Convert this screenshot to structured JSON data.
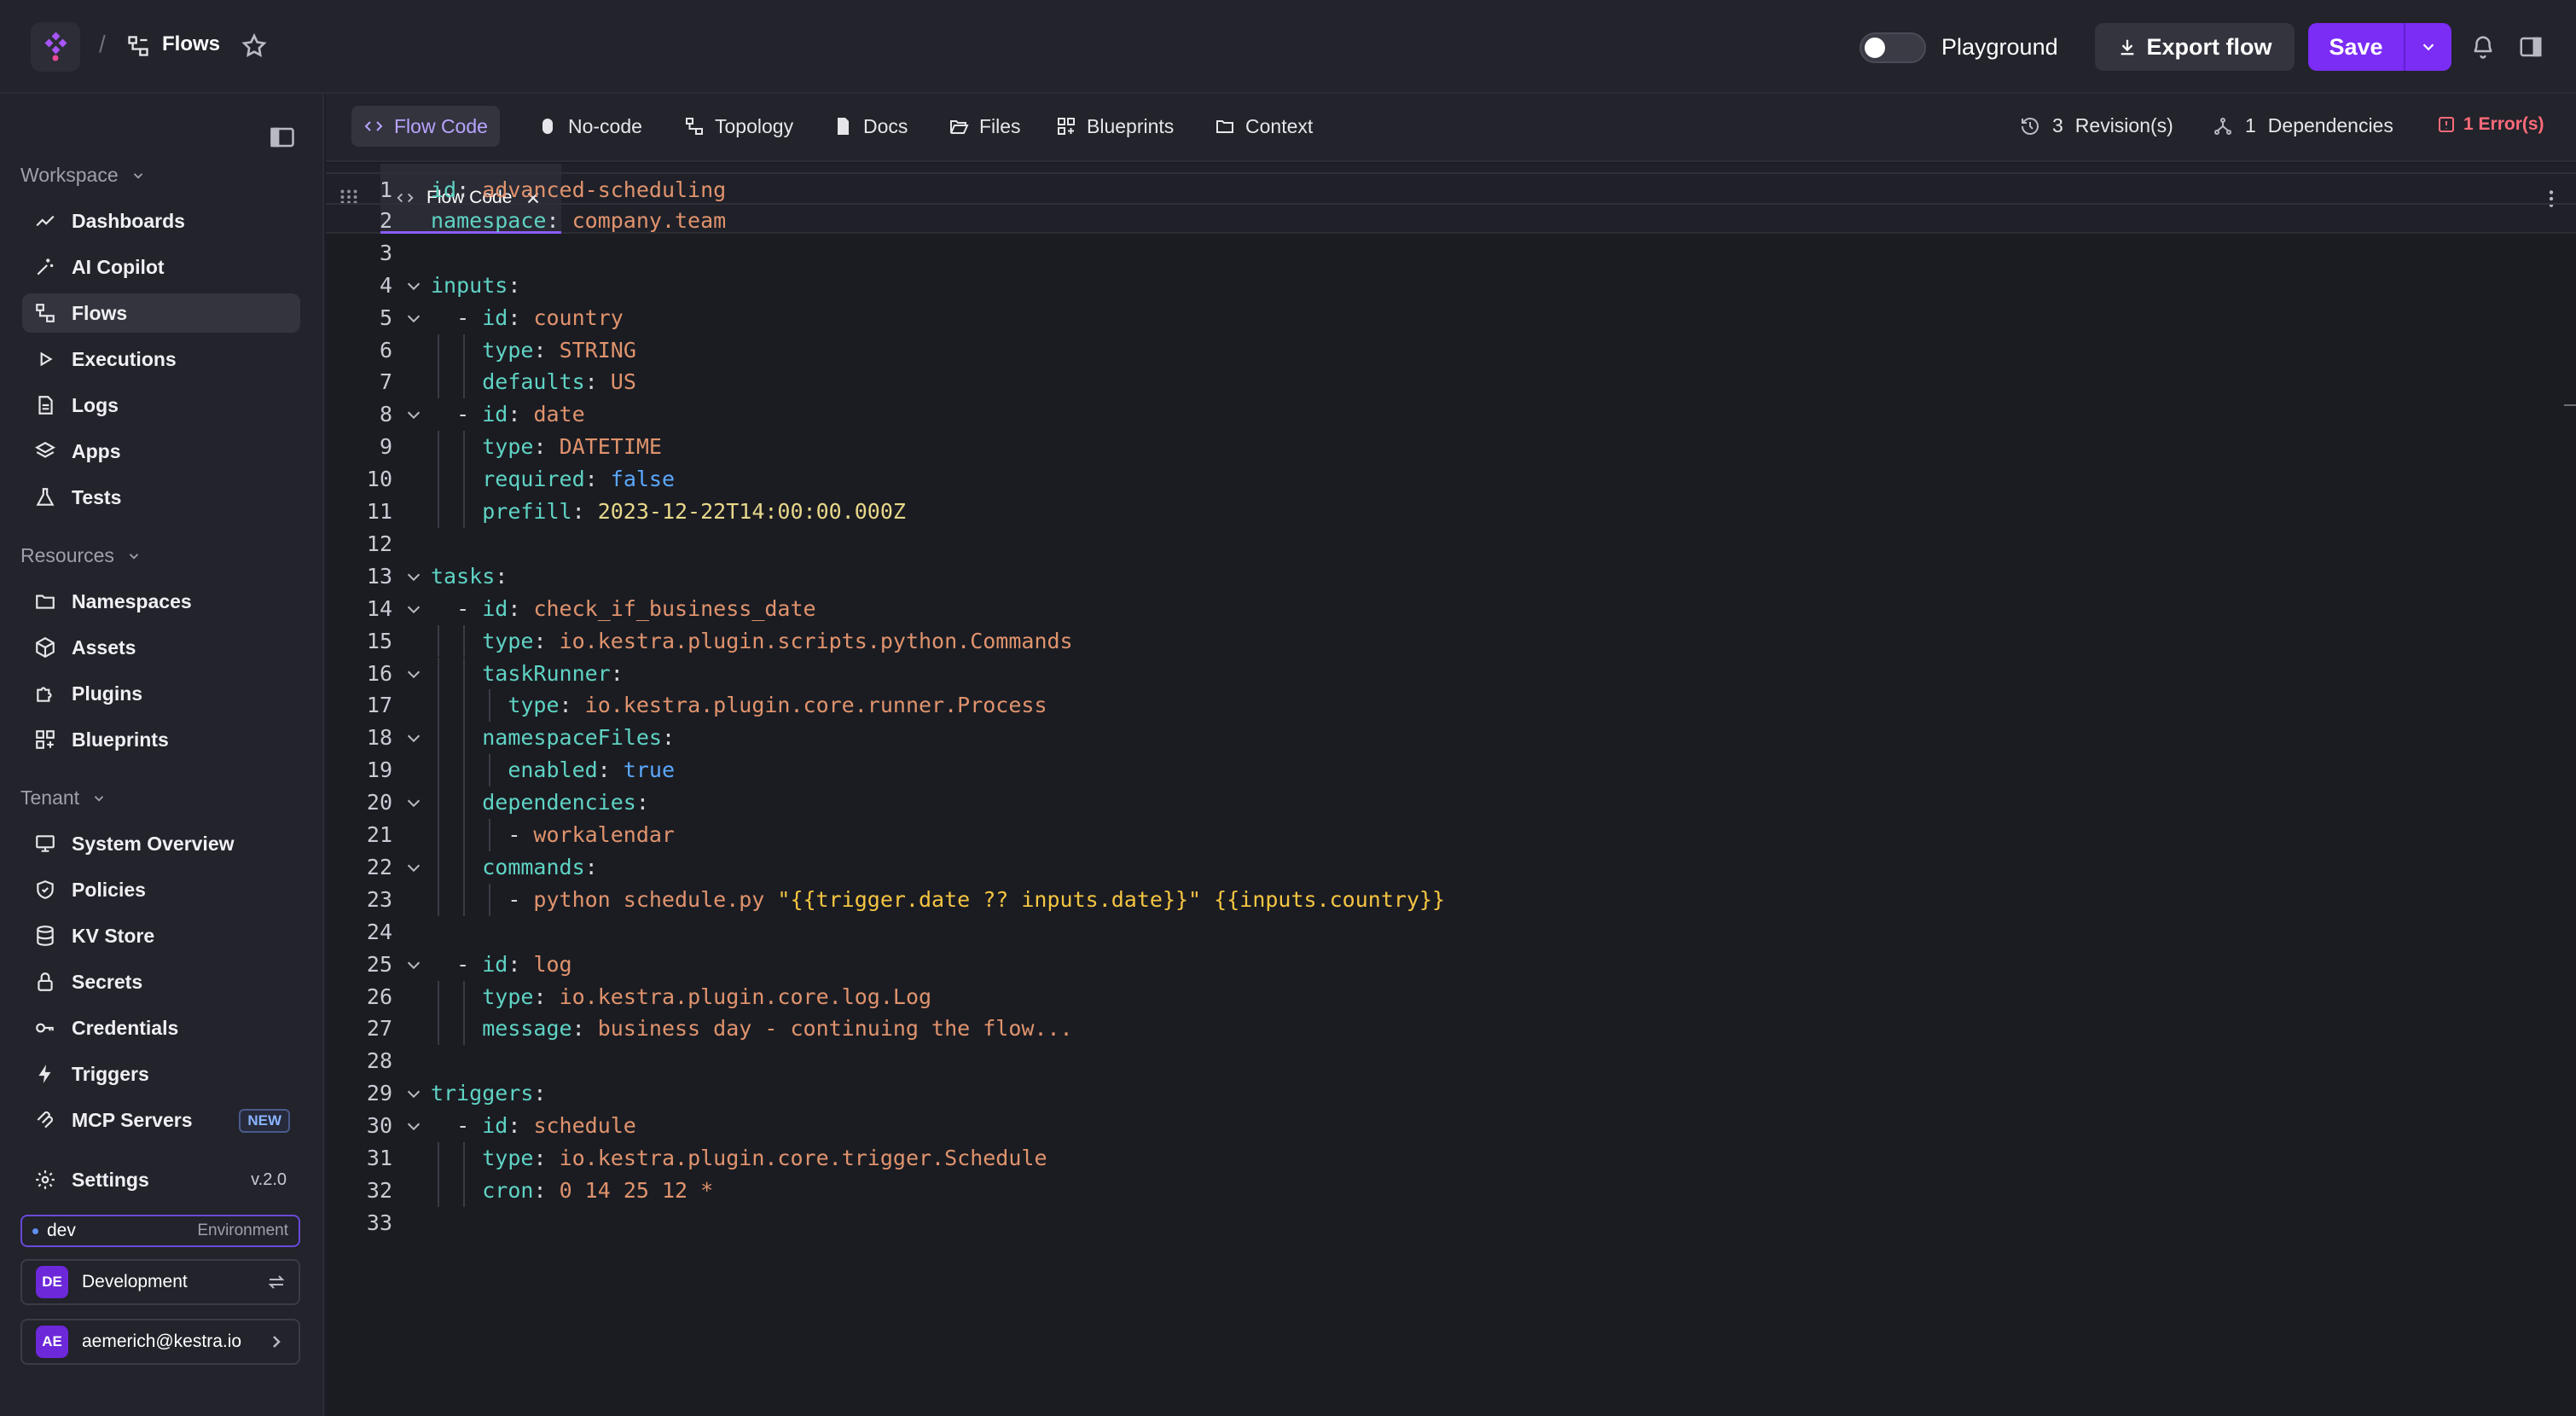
{
  "header": {
    "separator": "/",
    "title": "Flows",
    "playground_label": "Playground",
    "export_label": "Export flow",
    "save_label": "Save"
  },
  "sidebar": {
    "workspace_label": "Workspace",
    "workspace_items": [
      "Dashboards",
      "AI Copilot",
      "Flows",
      "Executions",
      "Logs",
      "Apps",
      "Tests"
    ],
    "resources_label": "Resources",
    "resources_items": [
      "Namespaces",
      "Assets",
      "Plugins",
      "Blueprints"
    ],
    "tenant_label": "Tenant",
    "tenant_items": [
      "System Overview",
      "Policies",
      "KV Store",
      "Secrets",
      "Credentials",
      "Triggers",
      "MCP Servers"
    ],
    "new_badge": "NEW",
    "settings_label": "Settings",
    "version": "v.2.0",
    "environment_name": "dev",
    "environment_label": "Environment",
    "tenant_initials": "DE",
    "tenant_name": "Development",
    "user_initials": "AE",
    "user_email": "aemerich@kestra.io"
  },
  "flow_tabs": [
    "Flow Code",
    "No-code",
    "Topology",
    "Docs",
    "Files",
    "Blueprints",
    "Context"
  ],
  "meta": {
    "revisions_count": "3",
    "revisions_label": "Revision(s)",
    "dependencies_count": "1",
    "dependencies_label": "Dependencies",
    "errors_label": "1 Error(s)"
  },
  "editor": {
    "tab_label": "Flow Code",
    "lines": [
      "id: advanced-scheduling",
      "namespace: company.team",
      "",
      "inputs:",
      "  - id: country",
      "    type: STRING",
      "    defaults: US",
      "  - id: date",
      "    type: DATETIME",
      "    required: false",
      "    prefill: 2023-12-22T14:00:00.000Z",
      "",
      "tasks:",
      "  - id: check_if_business_date",
      "    type: io.kestra.plugin.scripts.python.Commands",
      "    taskRunner:",
      "      type: io.kestra.plugin.core.runner.Process",
      "    namespaceFiles:",
      "      enabled: true",
      "    dependencies:",
      "      - workalendar",
      "    commands:",
      "      - python schedule.py \"{{trigger.date ?? inputs.date}}\" {{inputs.country}}",
      "",
      "  - id: log",
      "    type: io.kestra.plugin.core.log.Log",
      "    message: business day - continuing the flow...",
      "",
      "triggers:",
      "  - id: schedule",
      "    type: io.kestra.plugin.core.trigger.Schedule",
      "    cron: 0 14 25 12 *",
      ""
    ]
  }
}
